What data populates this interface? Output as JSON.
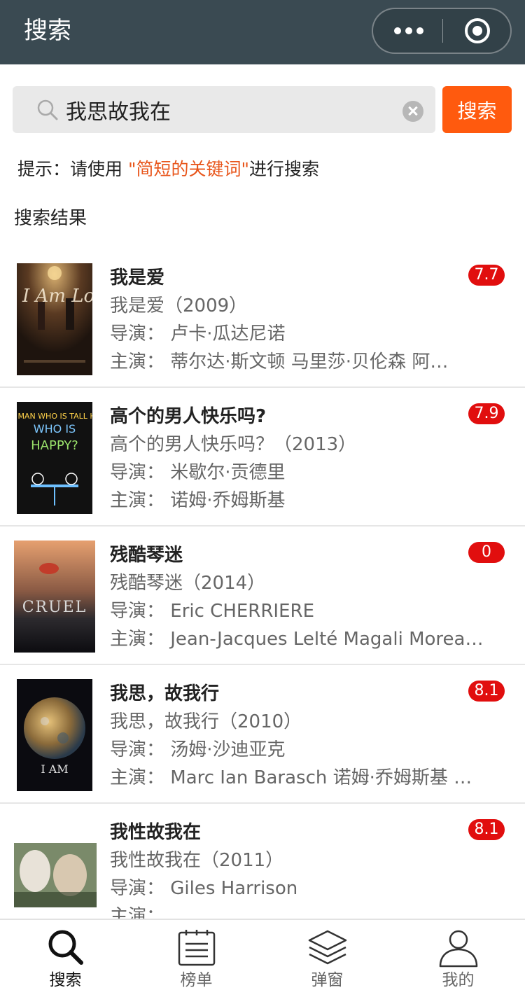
{
  "header": {
    "title": "搜索"
  },
  "search": {
    "value": "我思故我在",
    "button_label": "搜索"
  },
  "hint": {
    "prefix": "提示：请使用 ",
    "keyword": "\"简短的关键词\"",
    "suffix": "进行搜索"
  },
  "results_title": "搜索结果",
  "results": [
    {
      "title": "我是爱",
      "subtitle": "我是爱（2009）",
      "director": "导演：  卢卡·瓜达尼诺",
      "cast": "主演：  蒂尔达·斯文顿  马里莎·贝伦森  阿…",
      "rating": "7.7",
      "poster_text": "I Am Love"
    },
    {
      "title": "高个的男人快乐吗?",
      "subtitle": "高个的男人快乐吗？（2013）",
      "director": "导演：  米歇尔·贡德里",
      "cast": "主演：  诺姆·乔姆斯基",
      "rating": "7.9",
      "poster_text": "IS THE MAN WHO IS TALL HAPPY?"
    },
    {
      "title": "残酷琴迷",
      "subtitle": "残酷琴迷（2014）",
      "director": "导演：  Eric CHERRIERE",
      "cast": "主演：  Jean-Jacques Lelté  Magali Morea…",
      "rating": "0",
      "poster_text": "CRUEL"
    },
    {
      "title": "我思，故我行",
      "subtitle": "我思，故我行（2010）",
      "director": "导演：  汤姆·沙迪亚克",
      "cast": "主演：  Marc Ian Barasch  诺姆·乔姆斯基  …",
      "rating": "8.1",
      "poster_text": "I AM"
    },
    {
      "title": "我性故我在",
      "subtitle": "我性故我在（2011）",
      "director": "导演：  Giles Harrison",
      "cast": "主演：",
      "rating": "8.1",
      "poster_text": ""
    }
  ],
  "tabs": [
    {
      "label": "搜索",
      "icon": "search-icon",
      "active": true
    },
    {
      "label": "榜单",
      "icon": "list-icon",
      "active": false
    },
    {
      "label": "弹窗",
      "icon": "layers-icon",
      "active": false
    },
    {
      "label": "我的",
      "icon": "user-icon",
      "active": false
    }
  ],
  "colors": {
    "header": "#3a4a52",
    "accent": "#ff5a0e",
    "rating_badge": "#e10e0e"
  }
}
